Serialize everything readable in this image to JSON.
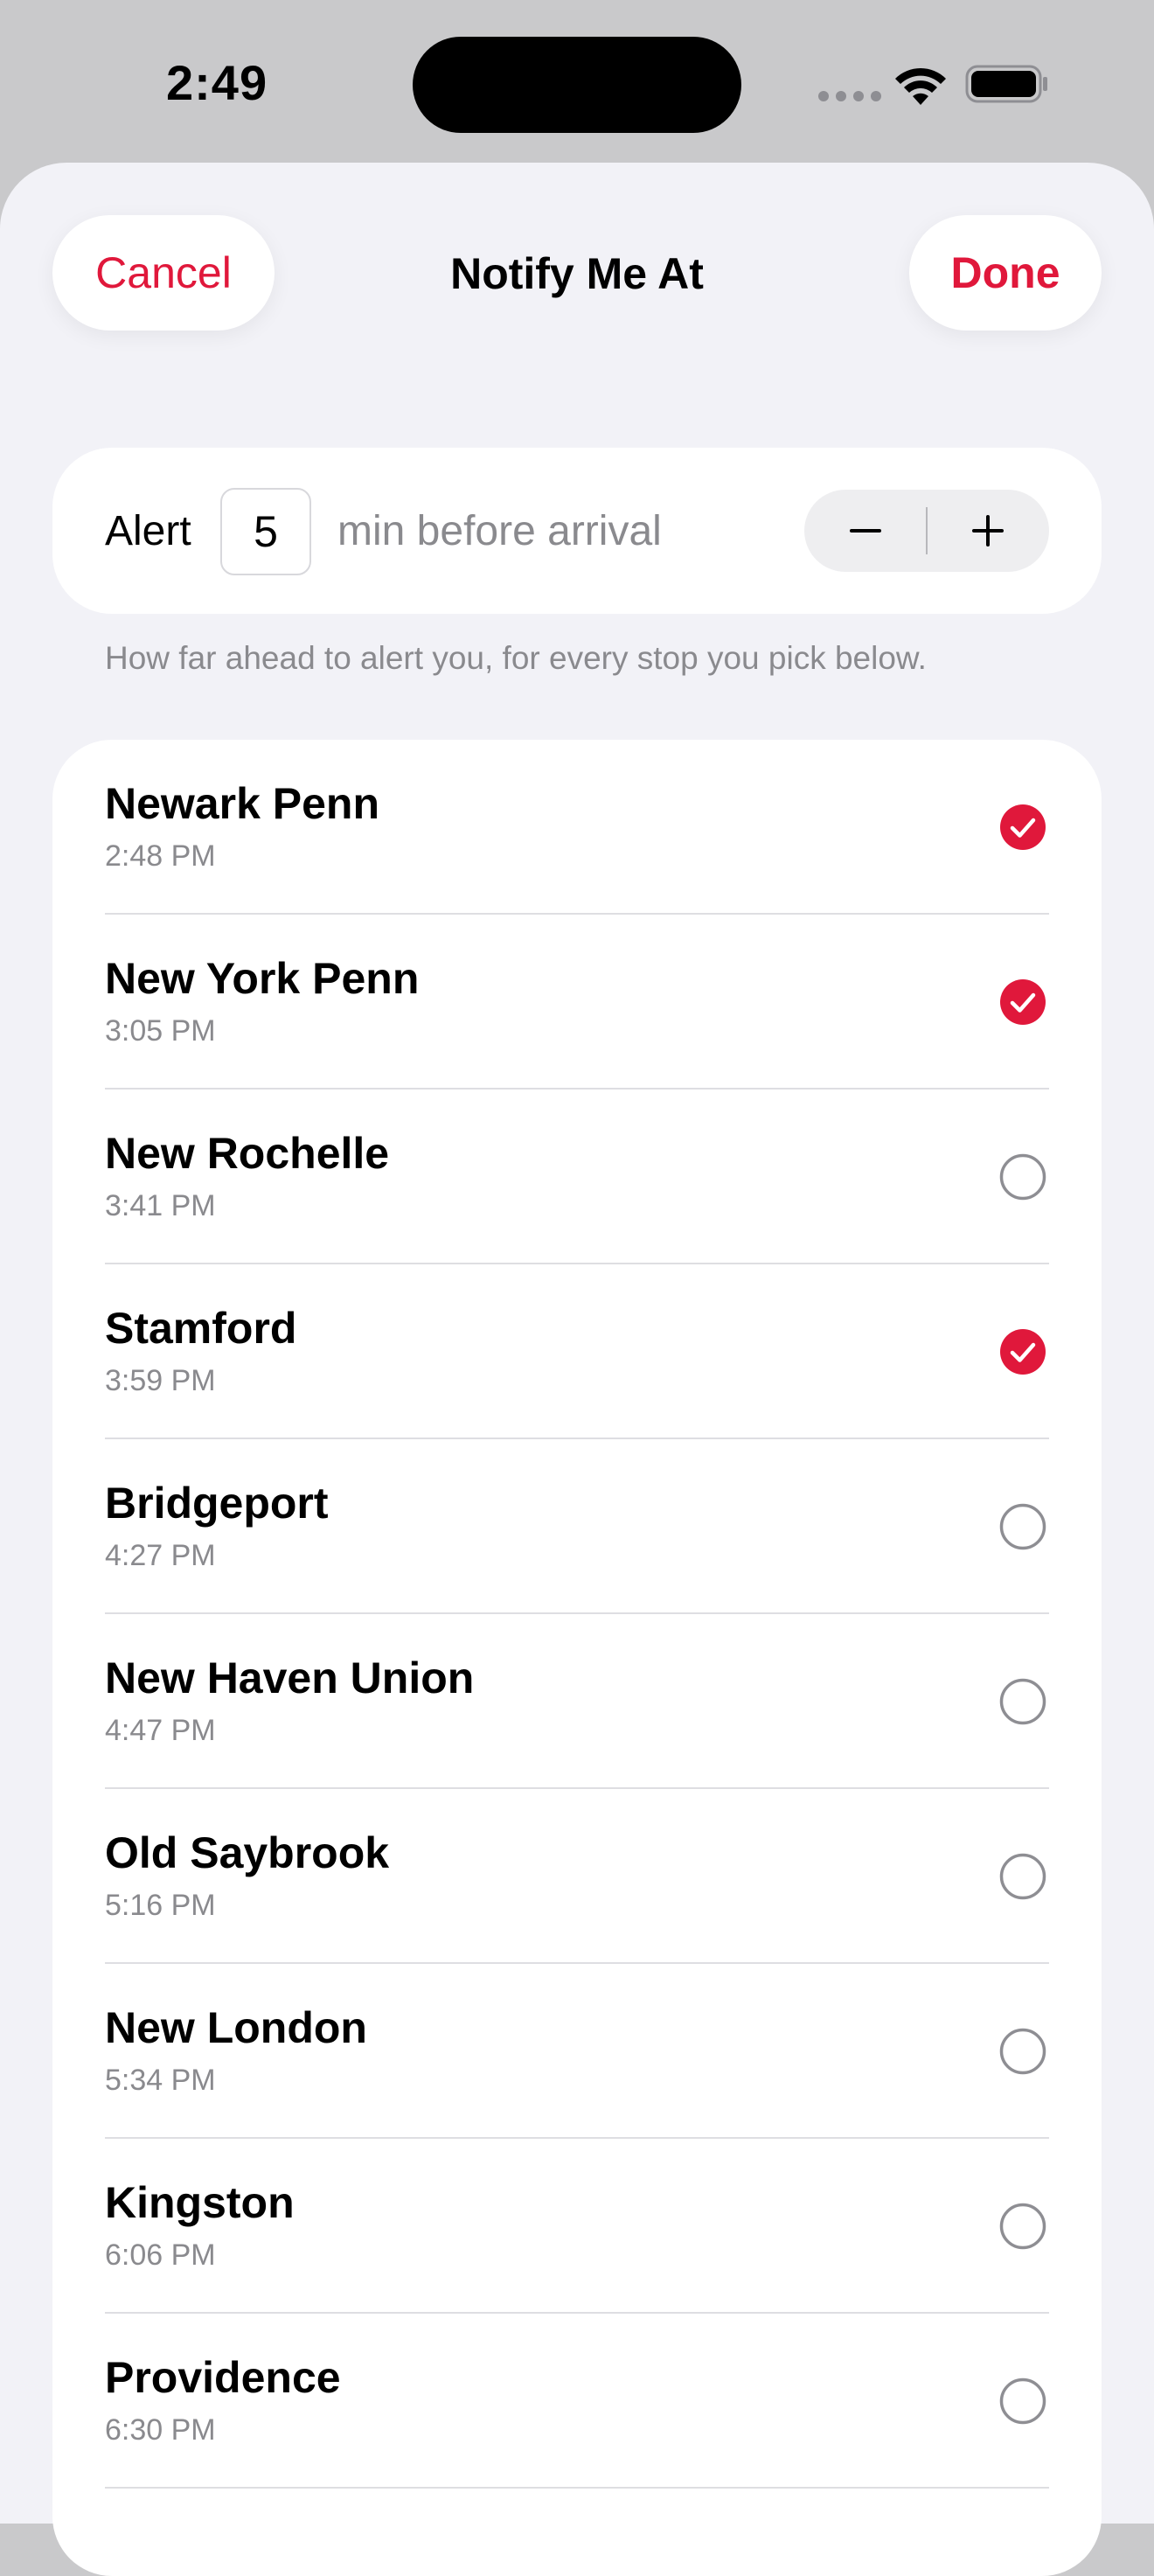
{
  "status_bar": {
    "time": "2:49"
  },
  "header": {
    "title": "Notify Me At",
    "cancel_label": "Cancel",
    "done_label": "Done"
  },
  "alert": {
    "prefix": "Alert",
    "minutes": "5",
    "suffix": "min before arrival",
    "helper": "How far ahead to alert you, for every stop you pick below."
  },
  "stops": [
    {
      "name": "Newark Penn",
      "time": "2:48 PM",
      "selected": true
    },
    {
      "name": "New York Penn",
      "time": "3:05 PM",
      "selected": true
    },
    {
      "name": "New Rochelle",
      "time": "3:41 PM",
      "selected": false
    },
    {
      "name": "Stamford",
      "time": "3:59 PM",
      "selected": true
    },
    {
      "name": "Bridgeport",
      "time": "4:27 PM",
      "selected": false
    },
    {
      "name": "New Haven Union",
      "time": "4:47 PM",
      "selected": false
    },
    {
      "name": "Old Saybrook",
      "time": "5:16 PM",
      "selected": false
    },
    {
      "name": "New London",
      "time": "5:34 PM",
      "selected": false
    },
    {
      "name": "Kingston",
      "time": "6:06 PM",
      "selected": false
    },
    {
      "name": "Providence",
      "time": "6:30 PM",
      "selected": false
    }
  ],
  "colors": {
    "accent": "#e0183b",
    "sheet_background": "#f2f2f7",
    "secondary_text": "#8a8a8e"
  },
  "icons": {
    "selected": "checkmark-circle-filled-icon",
    "unselected": "empty-circle-icon"
  }
}
